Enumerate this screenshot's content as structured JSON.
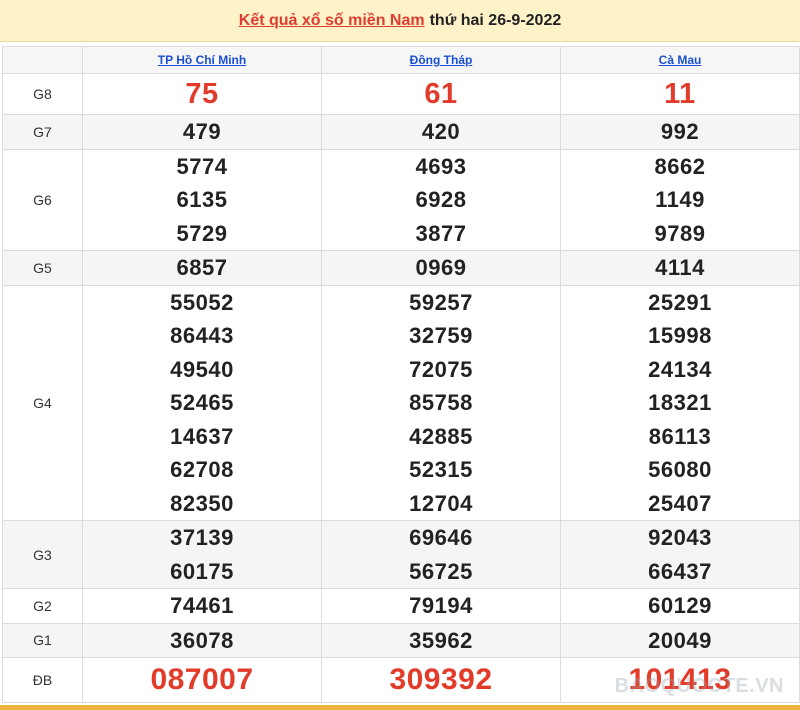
{
  "header": {
    "title": "Kết quả xổ số miền Nam",
    "date_text": "thứ hai 26-9-2022"
  },
  "provinces": [
    "TP Hồ Chí Minh",
    "Đồng Tháp",
    "Cà Mau"
  ],
  "prizes": [
    {
      "key": "g8",
      "label": "G8",
      "values": [
        [
          "75"
        ],
        [
          "61"
        ],
        [
          "11"
        ]
      ]
    },
    {
      "key": "g7",
      "label": "G7",
      "values": [
        [
          "479"
        ],
        [
          "420"
        ],
        [
          "992"
        ]
      ]
    },
    {
      "key": "g6",
      "label": "G6",
      "values": [
        [
          "5774",
          "6135",
          "5729"
        ],
        [
          "4693",
          "6928",
          "3877"
        ],
        [
          "8662",
          "1149",
          "9789"
        ]
      ]
    },
    {
      "key": "g5",
      "label": "G5",
      "values": [
        [
          "6857"
        ],
        [
          "0969"
        ],
        [
          "4114"
        ]
      ]
    },
    {
      "key": "g4",
      "label": "G4",
      "values": [
        [
          "55052",
          "86443",
          "49540",
          "52465",
          "14637",
          "62708",
          "82350"
        ],
        [
          "59257",
          "32759",
          "72075",
          "85758",
          "42885",
          "52315",
          "12704"
        ],
        [
          "25291",
          "15998",
          "24134",
          "18321",
          "86113",
          "56080",
          "25407"
        ]
      ]
    },
    {
      "key": "g3",
      "label": "G3",
      "values": [
        [
          "37139",
          "60175"
        ],
        [
          "69646",
          "56725"
        ],
        [
          "92043",
          "66437"
        ]
      ]
    },
    {
      "key": "g2",
      "label": "G2",
      "values": [
        [
          "74461"
        ],
        [
          "79194"
        ],
        [
          "60129"
        ]
      ]
    },
    {
      "key": "g1",
      "label": "G1",
      "values": [
        [
          "36078"
        ],
        [
          "35962"
        ],
        [
          "20049"
        ]
      ]
    },
    {
      "key": "db",
      "label": "ĐB",
      "values": [
        [
          "087007"
        ],
        [
          "309392"
        ],
        [
          "101413"
        ]
      ]
    }
  ],
  "watermark": "BAOQUOCTE.VN",
  "colors": {
    "header_bg": "#fdf2c8",
    "accent_red": "#e23b2a",
    "link_blue": "#1a4fd0",
    "alt_row_bg": "#f5f5f5",
    "bottom_bar": "#f0b541"
  }
}
